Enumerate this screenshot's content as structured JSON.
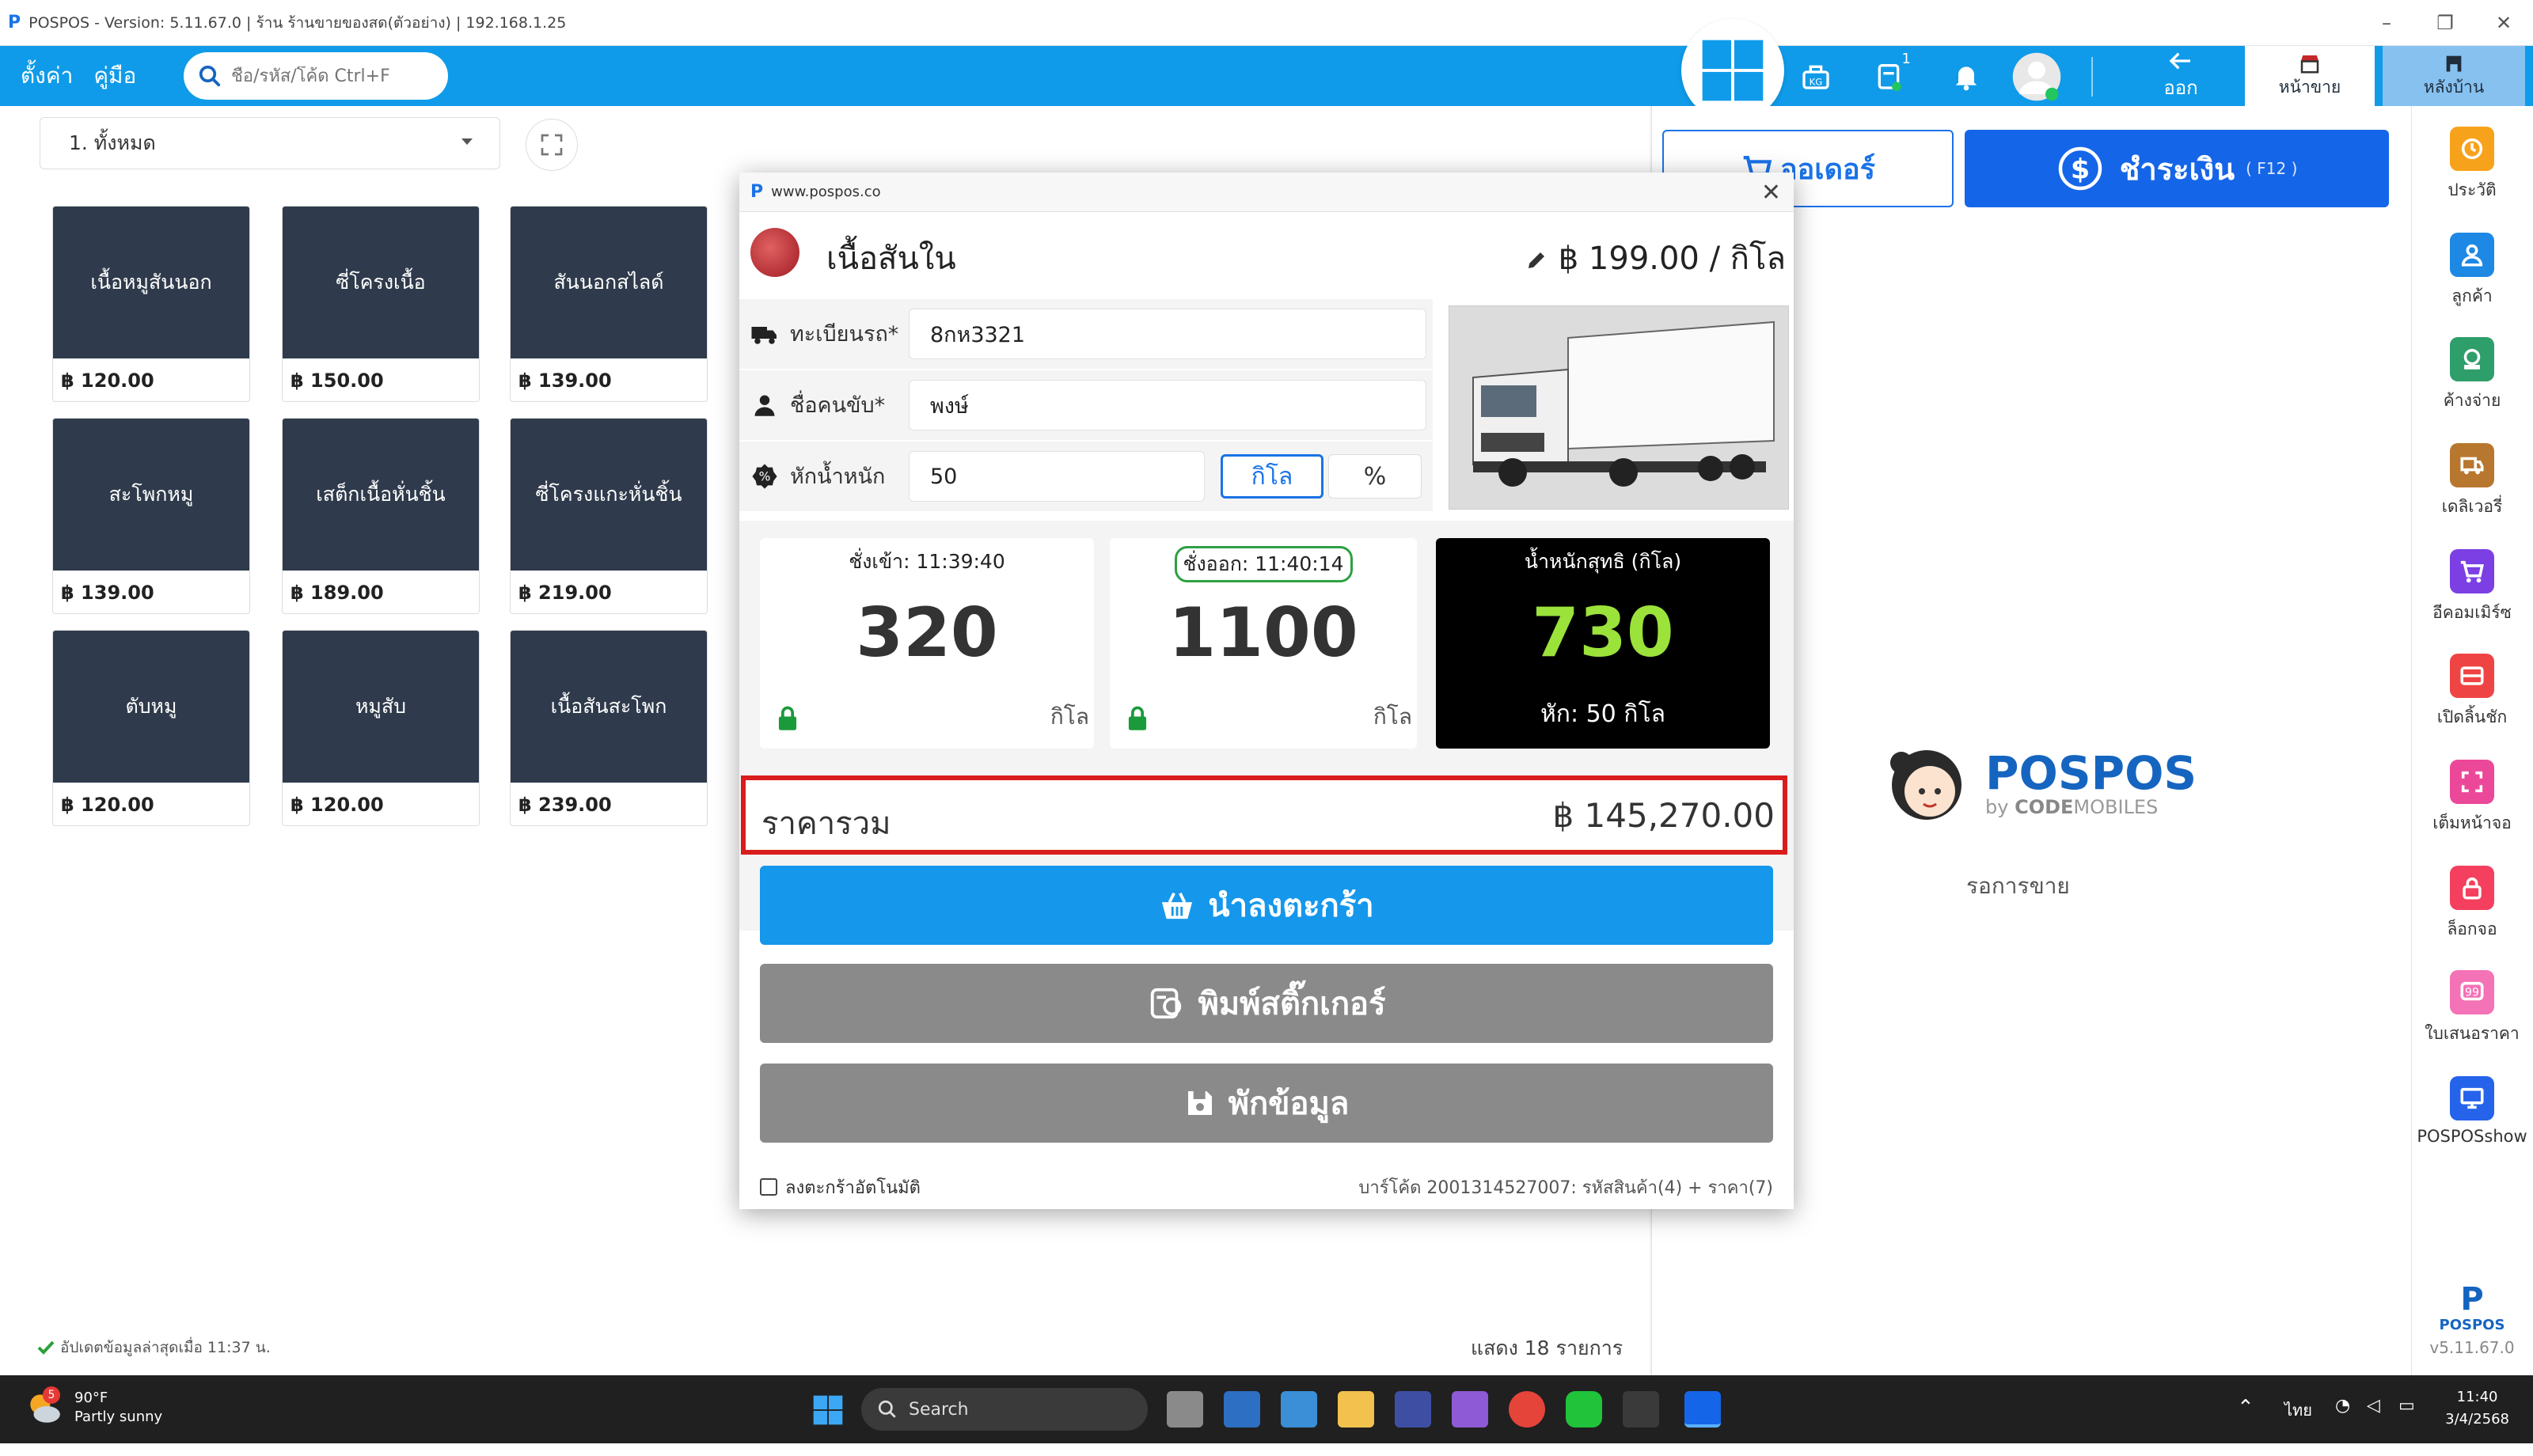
{
  "window": {
    "title": "POSPOS - Version: 5.11.67.0  |  ร้าน  ร้านขายของสด(ตัวอย่าง) | 192.168.1.25",
    "controls": {
      "minimize": "–",
      "restore": "❐",
      "close": "✕"
    }
  },
  "toolbar": {
    "settings": "ตั้งค่า",
    "manual": "คู่มือ",
    "search_placeholder": "ชื่อ/รหัส/โค้ด Ctrl+F",
    "notification_badge": "1",
    "logout": "ออก",
    "tab_sales": "หน้าขาย",
    "tab_back": "หลังบ้าน"
  },
  "category": {
    "selected": "1. ทั้งหมด"
  },
  "products": [
    {
      "name": "เนื้อหมูสันนอก",
      "price": "฿ 120.00"
    },
    {
      "name": "ซี่โครงเนื้อ",
      "price": "฿ 150.00"
    },
    {
      "name": "สันนอกสไลด์",
      "price": "฿ 139.00"
    },
    {
      "name": "สะโพกหมู",
      "price": "฿ 139.00"
    },
    {
      "name": "เสต็กเนื้อหั่นชิ้น",
      "price": "฿ 189.00"
    },
    {
      "name": "ซี่โครงแกะหั่นชิ้น",
      "price": "฿ 219.00"
    },
    {
      "name": "ตับหมู",
      "price": "฿ 120.00"
    },
    {
      "name": "หมูสับ",
      "price": "฿ 120.00"
    },
    {
      "name": "เนื้อสันสะโพก",
      "price": "฿ 239.00"
    }
  ],
  "status": {
    "updated": "อัปเดตข้อมูลล่าสุดเมื่อ 11:37 น.",
    "count": "แสดง 18 รายการ"
  },
  "order": {
    "order_label": "ออเดอร์",
    "pay_label": "ชำระเงิน",
    "pay_shortcut": "( F12 )",
    "brand_name": "POSPOS",
    "brand_sub_by": "by ",
    "brand_sub_code": "CODE",
    "brand_sub_rest": "MOBILES",
    "waiting": "รอการขาย"
  },
  "sidebar": [
    {
      "label": "ประวัติ",
      "color": "#f7a21b",
      "icon": "history-icon"
    },
    {
      "label": "ลูกค้า",
      "color": "#1e88e5",
      "icon": "customer-icon"
    },
    {
      "label": "ค้างจ่าย",
      "color": "#2e9e6a",
      "icon": "pending-icon"
    },
    {
      "label": "เดลิเวอรี่",
      "color": "#b8772e",
      "icon": "delivery-icon"
    },
    {
      "label": "อีคอมเมิร์ซ",
      "color": "#7b3fe4",
      "icon": "ecommerce-icon"
    },
    {
      "label": "เปิดลิ้นชัก",
      "color": "#ef4444",
      "icon": "drawer-icon"
    },
    {
      "label": "เต็มหน้าจอ",
      "color": "#ec4899",
      "icon": "fullscreen-icon"
    },
    {
      "label": "ล็อกจอ",
      "color": "#f43f5e",
      "icon": "lock-icon"
    },
    {
      "label": "ใบเสนอราคา",
      "color": "#f472b6",
      "icon": "quotation-icon"
    },
    {
      "label": "POSPOSshow",
      "color": "#2563eb",
      "icon": "display-icon"
    }
  ],
  "sidebar_footer": {
    "logo": "P",
    "name": "POSPOS",
    "version": "v5.11.67.0"
  },
  "modal": {
    "url": "www.pospos.co",
    "close": "✕",
    "product_name": "เนื้อสันใน",
    "unit_price": "฿ 199.00 / กิโล",
    "plate_label": "ทะเบียนรถ*",
    "plate_value": "8กห3321",
    "driver_label": "ชื่อคนขับ*",
    "driver_value": "พงษ์",
    "deduct_label": "หักน้ำหนัก",
    "deduct_value": "50",
    "unit_kilo": "กิโล",
    "unit_percent": "%",
    "weigh_in_label": "ชั่งเข้า: 11:39:40",
    "weigh_in_value": "320",
    "weigh_out_label": "ชั่งออก: 11:40:14",
    "weigh_out_value": "1100",
    "net_label": "น้ำหนักสุทธิ (กิโล)",
    "net_value": "730",
    "net_deduct": "หัก: 50 กิโล",
    "unit": "กิโล",
    "total_label": "ราคารวม",
    "total_value": "฿ 145,270.00",
    "btn_cart": "นำลงตะกร้า",
    "btn_sticker": "พิมพ์สติ๊กเกอร์",
    "btn_hold": "พักข้อมูล",
    "auto_cart_label": "ลงตะกร้าอัตโนมัติ",
    "barcode_info": "บาร์โค้ด 2001314527007: รหัสสินค้า(4) + ราคา(7)"
  },
  "colors": {
    "toolbar": "#0f9be9",
    "primary_button": "#1597ec",
    "secondary_button": "#8a8a8a",
    "highlight": "#d91c1c",
    "net_weight": "#9be23b"
  },
  "taskbar": {
    "weather_badge": "5",
    "temperature": "90°F",
    "condition": "Partly sunny",
    "search": "Search",
    "lang": "ไทย",
    "time": "11:40",
    "date": "3/4/2568"
  }
}
